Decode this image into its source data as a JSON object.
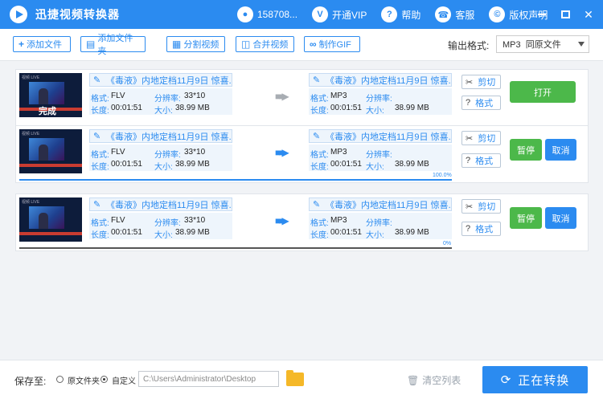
{
  "app": {
    "title": "迅捷视频转换器"
  },
  "titlebar": {
    "items": [
      {
        "label": "158708...",
        "icon": "user-icon"
      },
      {
        "label": "开通VIP",
        "icon": "vip-icon"
      },
      {
        "label": "帮助",
        "icon": "help-icon"
      },
      {
        "label": "客服",
        "icon": "headset-icon"
      },
      {
        "label": "版权声明",
        "icon": "copyright-icon"
      }
    ]
  },
  "toolbar": {
    "add_file": "添加文件",
    "add_folder": "添加文件夹",
    "split_video": "分割视频",
    "merge_video": "合并视频",
    "make_gif": "制作GIF",
    "output_label": "输出格式:",
    "output_value": "MP3  同原文件"
  },
  "labels": {
    "format": "格式:",
    "resolution": "分辨率:",
    "length": "长度:",
    "size": "大小:",
    "cut": "剪切",
    "fmt_btn": "格式"
  },
  "rows": [
    {
      "name": "《毒液》内地定档11月9日 惊喜.",
      "format": "FLV",
      "resolution": "33*10",
      "length": "00:01:51",
      "size": "38.99 MB",
      "out_name": "《毒液》内地定档11月9日 惊喜.",
      "out_format": "MP3",
      "out_resolution": "",
      "out_length": "00:01:51",
      "out_size": "38.99 MB",
      "status_overlay": "完成",
      "action1": "打开",
      "progress_text": "",
      "progress": 0
    },
    {
      "name": "《毒液》内地定档11月9日 惊喜.",
      "format": "FLV",
      "resolution": "33*10",
      "length": "00:01:51",
      "size": "38.99 MB",
      "out_name": "《毒液》内地定档11月9日 惊喜.",
      "out_format": "MP3",
      "out_resolution": "",
      "out_length": "00:01:51",
      "out_size": "38.99 MB",
      "action1": "暂停",
      "action2": "取消",
      "progress_text": "100.0%",
      "progress": 1.0
    },
    {
      "name": "《毒液》内地定档11月9日 惊喜.",
      "format": "FLV",
      "resolution": "33*10",
      "length": "00:01:51",
      "size": "38.99 MB",
      "out_name": "《毒液》内地定档11月9日 惊喜.",
      "out_format": "MP3",
      "out_resolution": "",
      "out_length": "00:01:51",
      "out_size": "38.99 MB",
      "action1": "暂停",
      "action2": "取消",
      "progress_text": "0%",
      "progress": 0
    }
  ],
  "footer": {
    "save_to": "保存至:",
    "option_original": "原文件夹",
    "option_custom": "自定义",
    "path": "C:\\Users\\Administrator\\Desktop",
    "clear_list": "清空列表",
    "convert": "正在转换"
  },
  "colors": {
    "accent": "#2b8bf0",
    "open_button": "#4cb84a",
    "pause_button": "#4cb84a",
    "cancel_button": "#2b8bf0"
  }
}
